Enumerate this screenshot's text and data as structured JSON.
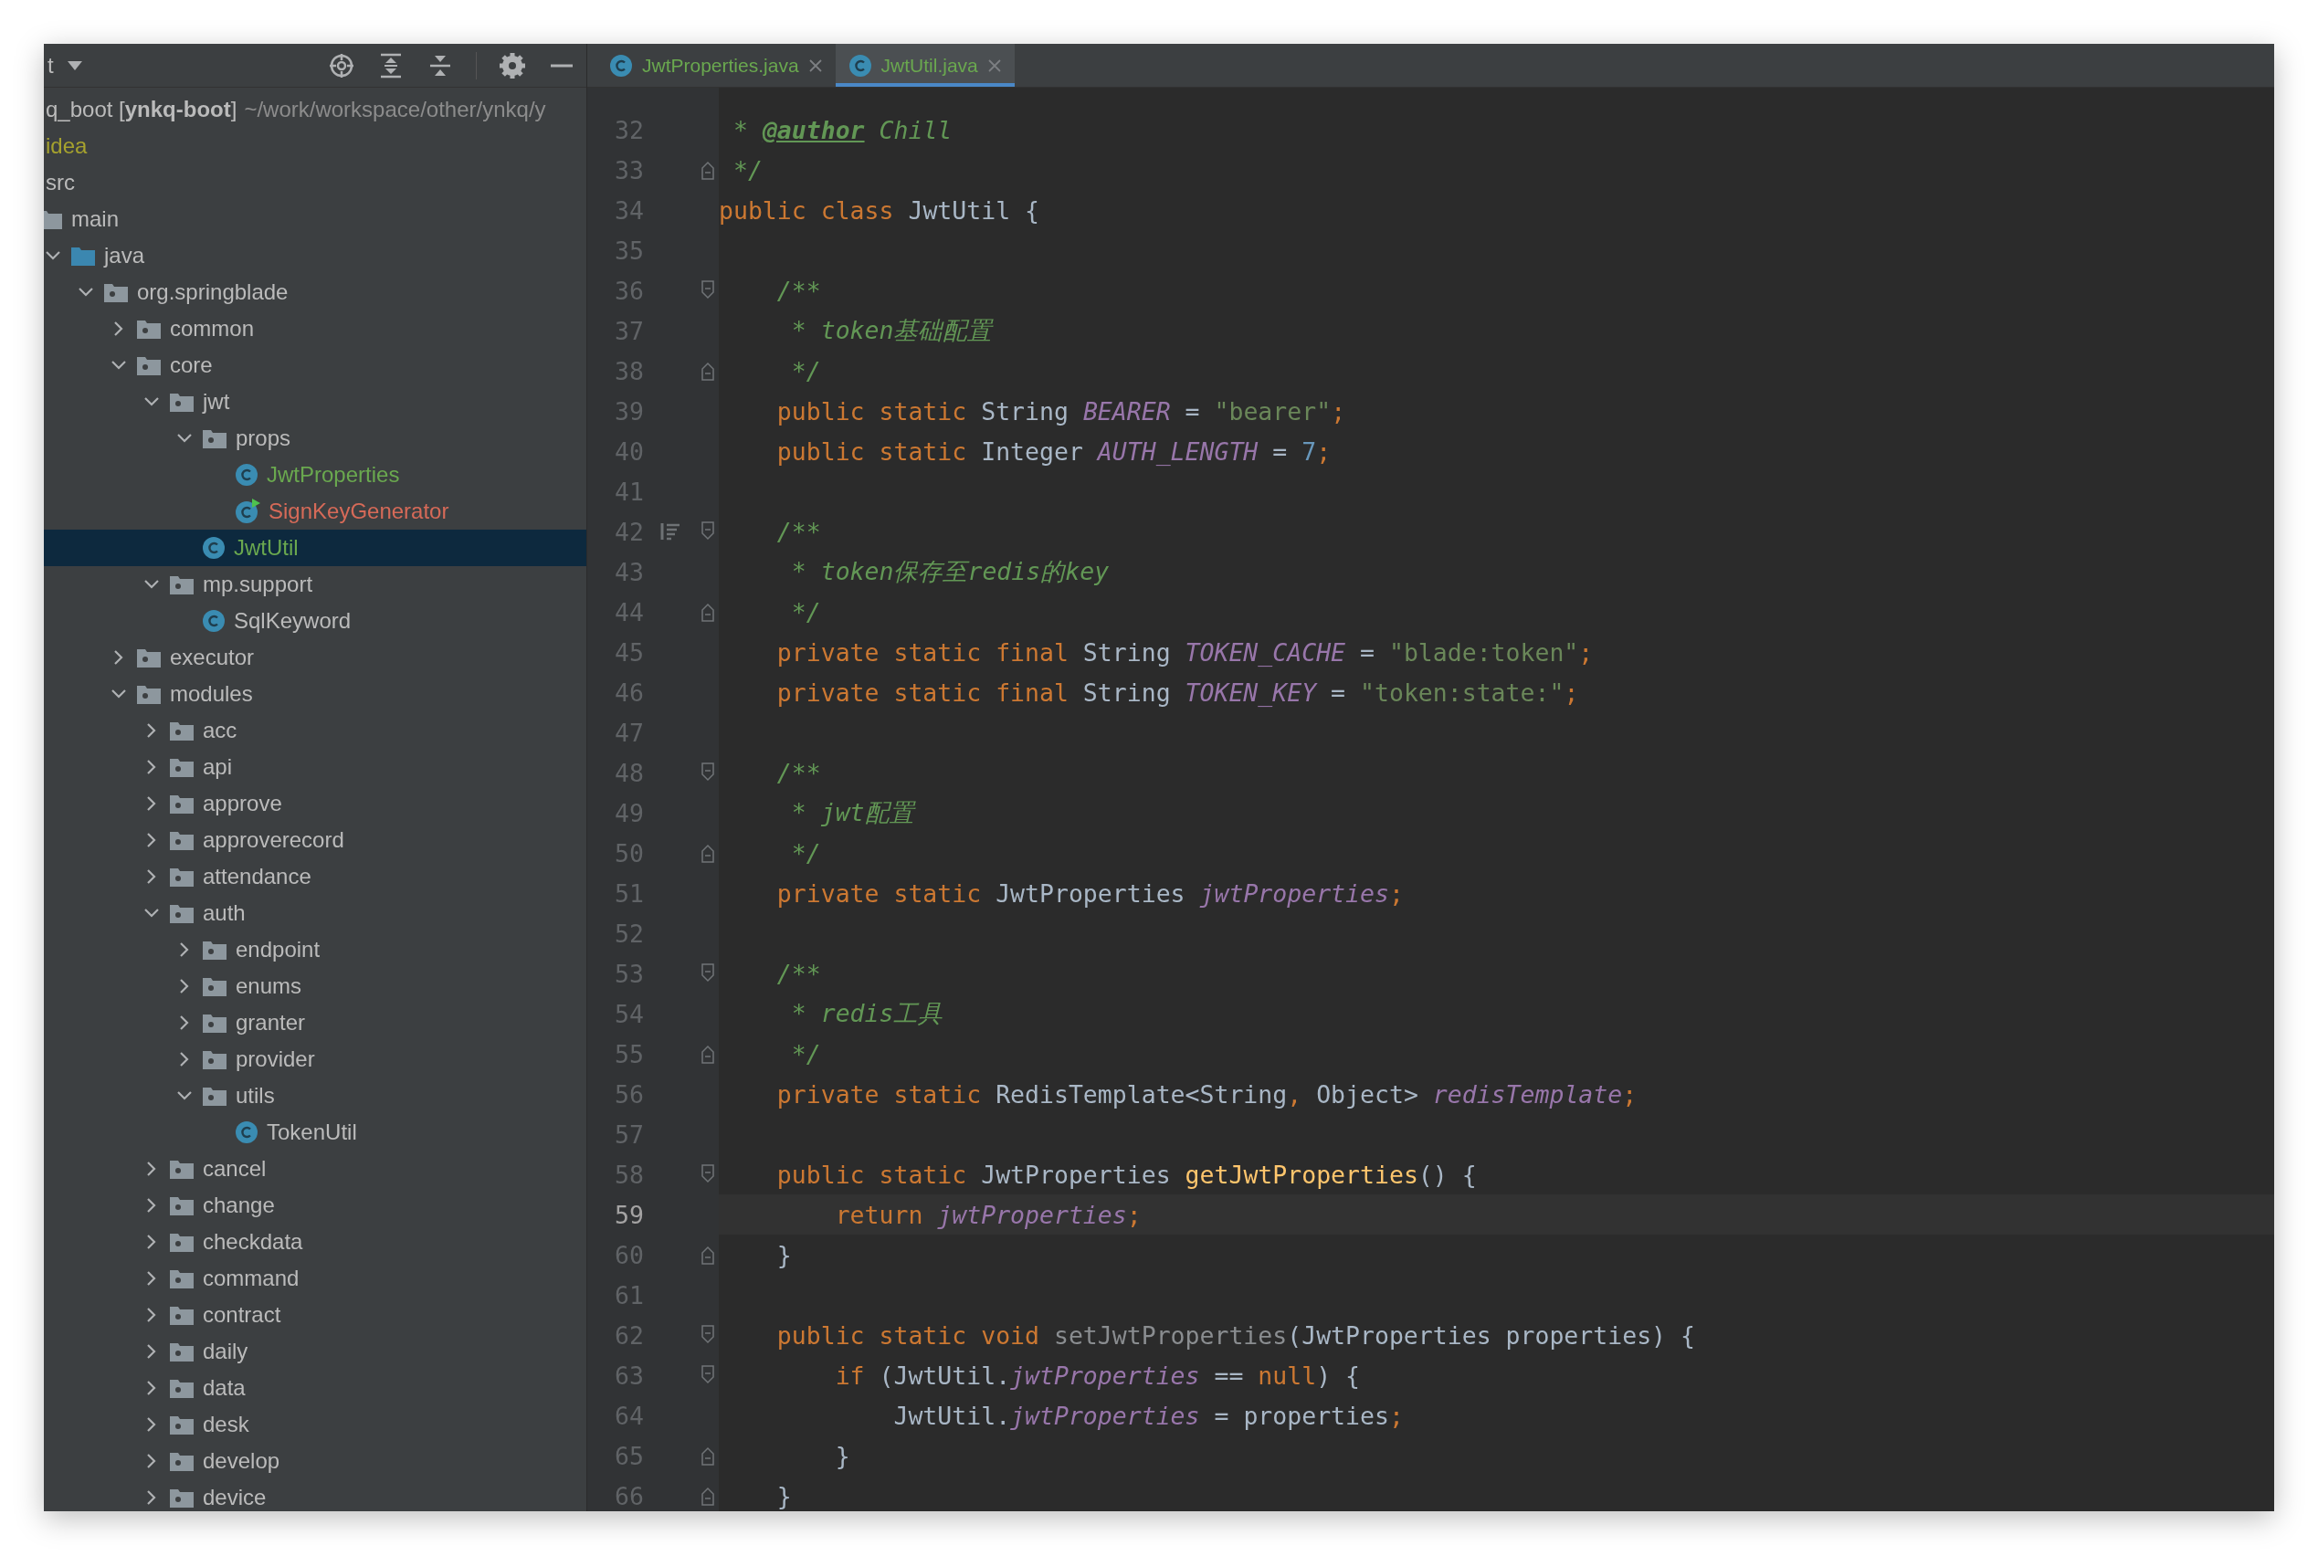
{
  "project_panel": {
    "title": "t"
  },
  "project_tree": [
    {
      "label": "q_boot [**ynkq-boot**]",
      "path": "~/work/workspace/other/ynkq/y",
      "color": "#bbbbbb",
      "selected": false,
      "children": [
        {
          "label": "idea",
          "color": "#a6a22e",
          "selected": false
        },
        {
          "label": "src",
          "color": "#bbbbbb",
          "selected": false,
          "children": [
            {
              "label": "main",
              "kind": "folder",
              "color": "#bbbbbb",
              "selected": false,
              "children": [
                {
                  "label": "java",
                  "kind": "source-folder",
                  "expanded": true,
                  "color": "#bbbbbb",
                  "selected": false,
                  "children": [
                    {
                      "label": "org.springblade",
                      "kind": "package",
                      "expanded": true,
                      "color": "#bbbbbb",
                      "selected": false,
                      "children": [
                        {
                          "label": "common",
                          "kind": "package",
                          "expanded": false,
                          "color": "#bbbbbb",
                          "selected": false
                        },
                        {
                          "label": "core",
                          "kind": "package",
                          "expanded": true,
                          "color": "#bbbbbb",
                          "selected": false,
                          "children": [
                            {
                              "label": "jwt",
                              "kind": "package",
                              "expanded": true,
                              "color": "#bbbbbb",
                              "selected": false,
                              "children": [
                                {
                                  "label": "props",
                                  "kind": "package",
                                  "expanded": true,
                                  "color": "#bbbbbb",
                                  "selected": false,
                                  "children": [
                                    {
                                      "label": "JwtProperties",
                                      "kind": "class",
                                      "color": "#6aa84f",
                                      "selected": false
                                    },
                                    {
                                      "label": "SignKeyGenerator",
                                      "kind": "runnable-class",
                                      "color": "#d66a58",
                                      "selected": false
                                    }
                                  ]
                                },
                                {
                                  "label": "JwtUtil",
                                  "kind": "class",
                                  "color": "#6aa84f",
                                  "selected": true
                                }
                              ]
                            },
                            {
                              "label": "mp.support",
                              "kind": "package",
                              "expanded": true,
                              "color": "#bbbbbb",
                              "selected": false,
                              "children": [
                                {
                                  "label": "SqlKeyword",
                                  "kind": "class",
                                  "color": "#bbbbbb",
                                  "selected": false
                                }
                              ]
                            }
                          ]
                        },
                        {
                          "label": "executor",
                          "kind": "package",
                          "expanded": false,
                          "color": "#bbbbbb",
                          "selected": false
                        },
                        {
                          "label": "modules",
                          "kind": "package",
                          "expanded": true,
                          "color": "#bbbbbb",
                          "selected": false,
                          "children": [
                            {
                              "label": "acc",
                              "kind": "package",
                              "expanded": false,
                              "color": "#bbbbbb",
                              "selected": false
                            },
                            {
                              "label": "api",
                              "kind": "package",
                              "expanded": false,
                              "color": "#bbbbbb",
                              "selected": false
                            },
                            {
                              "label": "approve",
                              "kind": "package",
                              "expanded": false,
                              "color": "#bbbbbb",
                              "selected": false
                            },
                            {
                              "label": "approverecord",
                              "kind": "package",
                              "expanded": false,
                              "color": "#bbbbbb",
                              "selected": false
                            },
                            {
                              "label": "attendance",
                              "kind": "package",
                              "expanded": false,
                              "color": "#bbbbbb",
                              "selected": false
                            },
                            {
                              "label": "auth",
                              "kind": "package",
                              "expanded": true,
                              "color": "#bbbbbb",
                              "selected": false,
                              "children": [
                                {
                                  "label": "endpoint",
                                  "kind": "package",
                                  "expanded": false,
                                  "color": "#bbbbbb",
                                  "selected": false
                                },
                                {
                                  "label": "enums",
                                  "kind": "package",
                                  "expanded": false,
                                  "color": "#bbbbbb",
                                  "selected": false
                                },
                                {
                                  "label": "granter",
                                  "kind": "package",
                                  "expanded": false,
                                  "color": "#bbbbbb",
                                  "selected": false
                                },
                                {
                                  "label": "provider",
                                  "kind": "package",
                                  "expanded": false,
                                  "color": "#bbbbbb",
                                  "selected": false
                                },
                                {
                                  "label": "utils",
                                  "kind": "package",
                                  "expanded": true,
                                  "color": "#bbbbbb",
                                  "selected": false,
                                  "children": [
                                    {
                                      "label": "TokenUtil",
                                      "kind": "class",
                                      "color": "#bbbbbb",
                                      "selected": false
                                    }
                                  ]
                                }
                              ]
                            },
                            {
                              "label": "cancel",
                              "kind": "package",
                              "expanded": false,
                              "color": "#bbbbbb",
                              "selected": false
                            },
                            {
                              "label": "change",
                              "kind": "package",
                              "expanded": false,
                              "color": "#bbbbbb",
                              "selected": false
                            },
                            {
                              "label": "checkdata",
                              "kind": "package",
                              "expanded": false,
                              "color": "#bbbbbb",
                              "selected": false
                            },
                            {
                              "label": "command",
                              "kind": "package",
                              "expanded": false,
                              "color": "#bbbbbb",
                              "selected": false
                            },
                            {
                              "label": "contract",
                              "kind": "package",
                              "expanded": false,
                              "color": "#bbbbbb",
                              "selected": false
                            },
                            {
                              "label": "daily",
                              "kind": "package",
                              "expanded": false,
                              "color": "#bbbbbb",
                              "selected": false
                            },
                            {
                              "label": "data",
                              "kind": "package",
                              "expanded": false,
                              "color": "#bbbbbb",
                              "selected": false
                            },
                            {
                              "label": "desk",
                              "kind": "package",
                              "expanded": false,
                              "color": "#bbbbbb",
                              "selected": false
                            },
                            {
                              "label": "develop",
                              "kind": "package",
                              "expanded": false,
                              "color": "#bbbbbb",
                              "selected": false
                            },
                            {
                              "label": "device",
                              "kind": "package",
                              "expanded": false,
                              "color": "#bbbbbb",
                              "selected": false
                            }
                          ]
                        }
                      ]
                    }
                  ]
                }
              ]
            }
          ]
        }
      ]
    }
  ],
  "tabs": [
    {
      "label": "JwtProperties.java",
      "color": "#6aa84f",
      "selected": false
    },
    {
      "label": "JwtUtil.java",
      "color": "#6aa84f",
      "selected": true
    }
  ],
  "code_lines": [
    {
      "number": "32",
      "current": false,
      "fold_start": false,
      "fold_end": false,
      "tokens": [
        {
          "kind": "comment",
          "text": " * "
        },
        {
          "kind": "tag",
          "text": "@author"
        },
        {
          "kind": "comment",
          "text": " Chill"
        }
      ]
    },
    {
      "number": "33",
      "current": false,
      "fold_start": false,
      "fold_end": true,
      "tokens": [
        {
          "kind": "comment",
          "text": " */"
        }
      ]
    },
    {
      "number": "34",
      "current": false,
      "fold_start": false,
      "fold_end": false,
      "tokens": [
        {
          "kind": "keyword",
          "text": "public class "
        },
        {
          "kind": "plain",
          "text": "JwtUtil {"
        }
      ]
    },
    {
      "number": "35",
      "current": false,
      "fold_start": false,
      "fold_end": false
    },
    {
      "number": "36",
      "current": false,
      "fold_start": true,
      "fold_end": false,
      "tokens": [
        {
          "kind": "comment",
          "text": "    /**"
        }
      ]
    },
    {
      "number": "37",
      "current": false,
      "fold_start": false,
      "fold_end": false,
      "tokens": [
        {
          "kind": "comment",
          "text": "     * token基础配置"
        }
      ]
    },
    {
      "number": "38",
      "current": false,
      "fold_start": false,
      "fold_end": true,
      "tokens": [
        {
          "kind": "comment",
          "text": "     */"
        }
      ]
    },
    {
      "number": "39",
      "current": false,
      "fold_start": false,
      "fold_end": false,
      "tokens": [
        {
          "kind": "keyword",
          "text": "    public static "
        },
        {
          "kind": "plain",
          "text": "String "
        },
        {
          "kind": "field",
          "text": "BEARER"
        },
        {
          "kind": "plain",
          "text": " = "
        },
        {
          "kind": "string",
          "text": "\"bearer\""
        },
        {
          "kind": "keyword",
          "text": ";"
        }
      ]
    },
    {
      "number": "40",
      "current": false,
      "fold_start": false,
      "fold_end": false,
      "tokens": [
        {
          "kind": "keyword",
          "text": "    public static "
        },
        {
          "kind": "plain",
          "text": "Integer "
        },
        {
          "kind": "field",
          "text": "AUTH_LENGTH"
        },
        {
          "kind": "plain",
          "text": " = "
        },
        {
          "kind": "number",
          "text": "7"
        },
        {
          "kind": "keyword",
          "text": ";"
        }
      ]
    },
    {
      "number": "41",
      "current": false,
      "fold_start": false,
      "fold_end": false
    },
    {
      "number": "42",
      "current": false,
      "fold_start": true,
      "fold_end": false,
      "marker": true,
      "tokens": [
        {
          "kind": "comment",
          "text": "    /**"
        }
      ]
    },
    {
      "number": "43",
      "current": false,
      "fold_start": false,
      "fold_end": false,
      "tokens": [
        {
          "kind": "comment",
          "text": "     * token保存至redis的key"
        }
      ]
    },
    {
      "number": "44",
      "current": false,
      "fold_start": false,
      "fold_end": true,
      "tokens": [
        {
          "kind": "comment",
          "text": "     */"
        }
      ]
    },
    {
      "number": "45",
      "current": false,
      "fold_start": false,
      "fold_end": false,
      "tokens": [
        {
          "kind": "keyword",
          "text": "    private static final "
        },
        {
          "kind": "plain",
          "text": "String "
        },
        {
          "kind": "field",
          "text": "TOKEN_CACHE"
        },
        {
          "kind": "plain",
          "text": " = "
        },
        {
          "kind": "string",
          "text": "\"blade:token\""
        },
        {
          "kind": "keyword",
          "text": ";"
        }
      ]
    },
    {
      "number": "46",
      "current": false,
      "fold_start": false,
      "fold_end": false,
      "tokens": [
        {
          "kind": "keyword",
          "text": "    private static final "
        },
        {
          "kind": "plain",
          "text": "String "
        },
        {
          "kind": "field",
          "text": "TOKEN_KEY"
        },
        {
          "kind": "plain",
          "text": " = "
        },
        {
          "kind": "string",
          "text": "\"token:state:\""
        },
        {
          "kind": "keyword",
          "text": ";"
        }
      ]
    },
    {
      "number": "47",
      "current": false,
      "fold_start": false,
      "fold_end": false
    },
    {
      "number": "48",
      "current": false,
      "fold_start": true,
      "fold_end": false,
      "tokens": [
        {
          "kind": "comment",
          "text": "    /**"
        }
      ]
    },
    {
      "number": "49",
      "current": false,
      "fold_start": false,
      "fold_end": false,
      "tokens": [
        {
          "kind": "comment",
          "text": "     * jwt配置"
        }
      ]
    },
    {
      "number": "50",
      "current": false,
      "fold_start": false,
      "fold_end": true,
      "tokens": [
        {
          "kind": "comment",
          "text": "     */"
        }
      ]
    },
    {
      "number": "51",
      "current": false,
      "fold_start": false,
      "fold_end": false,
      "tokens": [
        {
          "kind": "keyword",
          "text": "    private static "
        },
        {
          "kind": "plain",
          "text": "JwtProperties "
        },
        {
          "kind": "field",
          "text": "jwtProperties"
        },
        {
          "kind": "keyword",
          "text": ";"
        }
      ]
    },
    {
      "number": "52",
      "current": false,
      "fold_start": false,
      "fold_end": false
    },
    {
      "number": "53",
      "current": false,
      "fold_start": true,
      "fold_end": false,
      "tokens": [
        {
          "kind": "comment",
          "text": "    /**"
        }
      ]
    },
    {
      "number": "54",
      "current": false,
      "fold_start": false,
      "fold_end": false,
      "tokens": [
        {
          "kind": "comment",
          "text": "     * redis工具"
        }
      ]
    },
    {
      "number": "55",
      "current": false,
      "fold_start": false,
      "fold_end": true,
      "tokens": [
        {
          "kind": "comment",
          "text": "     */"
        }
      ]
    },
    {
      "number": "56",
      "current": false,
      "fold_start": false,
      "fold_end": false,
      "tokens": [
        {
          "kind": "keyword",
          "text": "    private static "
        },
        {
          "kind": "plain",
          "text": "RedisTemplate<String"
        },
        {
          "kind": "keyword",
          "text": ", "
        },
        {
          "kind": "plain",
          "text": "Object> "
        },
        {
          "kind": "field",
          "text": "redisTemplate"
        },
        {
          "kind": "keyword",
          "text": ";"
        }
      ]
    },
    {
      "number": "57",
      "current": false,
      "fold_start": false,
      "fold_end": false
    },
    {
      "number": "58",
      "current": false,
      "fold_start": true,
      "fold_end": false,
      "tokens": [
        {
          "kind": "keyword",
          "text": "    public static "
        },
        {
          "kind": "plain",
          "text": "JwtProperties "
        },
        {
          "kind": "method",
          "text": "getJwtProperties"
        },
        {
          "kind": "plain",
          "text": "() {"
        }
      ]
    },
    {
      "number": "59",
      "current": true,
      "fold_start": false,
      "fold_end": false,
      "tokens": [
        {
          "kind": "keyword",
          "text": "        return "
        },
        {
          "kind": "field",
          "text": "jwtProperties"
        },
        {
          "kind": "keyword",
          "text": ";"
        }
      ]
    },
    {
      "number": "60",
      "current": false,
      "fold_start": false,
      "fold_end": true,
      "tokens": [
        {
          "kind": "plain",
          "text": "    }"
        }
      ]
    },
    {
      "number": "61",
      "current": false,
      "fold_start": false,
      "fold_end": false
    },
    {
      "number": "62",
      "current": false,
      "fold_start": true,
      "fold_end": false,
      "tokens": [
        {
          "kind": "keyword",
          "text": "    public static void "
        },
        {
          "kind": "unused",
          "text": "setJwtProperties"
        },
        {
          "kind": "plain",
          "text": "(JwtProperties properties) {"
        }
      ]
    },
    {
      "number": "63",
      "current": false,
      "fold_start": true,
      "fold_end": false,
      "tokens": [
        {
          "kind": "keyword",
          "text": "        if "
        },
        {
          "kind": "plain",
          "text": "(JwtUtil."
        },
        {
          "kind": "field",
          "text": "jwtProperties"
        },
        {
          "kind": "plain",
          "text": " == "
        },
        {
          "kind": "keyword",
          "text": "null"
        },
        {
          "kind": "plain",
          "text": ") {"
        }
      ]
    },
    {
      "number": "64",
      "current": false,
      "fold_start": false,
      "fold_end": false,
      "tokens": [
        {
          "kind": "plain",
          "text": "            JwtUtil."
        },
        {
          "kind": "field",
          "text": "jwtProperties"
        },
        {
          "kind": "plain",
          "text": " = properties"
        },
        {
          "kind": "keyword",
          "text": ";"
        }
      ]
    },
    {
      "number": "65",
      "current": false,
      "fold_start": false,
      "fold_end": true,
      "tokens": [
        {
          "kind": "plain",
          "text": "        }"
        }
      ]
    },
    {
      "number": "66",
      "current": false,
      "fold_start": false,
      "fold_end": true,
      "tokens": [
        {
          "kind": "plain",
          "text": "    }"
        }
      ]
    }
  ]
}
